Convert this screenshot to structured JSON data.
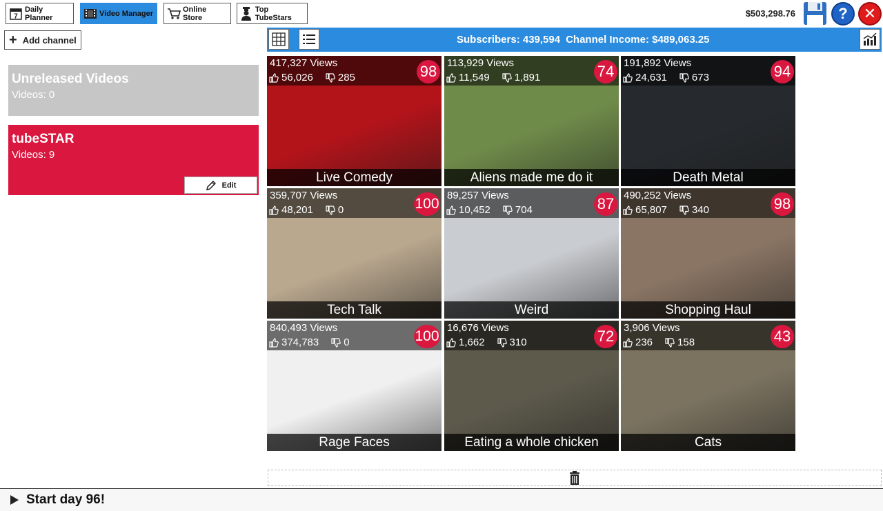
{
  "nav": {
    "daily_planner": "Daily Planner",
    "video_manager": "Video Manager",
    "online_store": "Online Store",
    "top_tubestars": "Top TubeStars",
    "calendar_day": "7"
  },
  "balance": "$503,298.76",
  "help_label": "?",
  "close_label": "✕",
  "sidebar": {
    "add_channel": "Add channel",
    "channels": [
      {
        "name": "Unreleased Videos",
        "videos": "Videos: 0"
      },
      {
        "name": "tubeSTAR",
        "videos": "Videos: 9",
        "edit_label": "Edit"
      }
    ]
  },
  "header": {
    "subscribers": "Subscribers: 439,594",
    "income": "Channel Income: $489,063.25"
  },
  "videos": [
    {
      "title": "Live Comedy",
      "views": "417,327 Views",
      "likes": "56,026",
      "dislikes": "285",
      "score": "98",
      "color": "#b2141a"
    },
    {
      "title": "Aliens made me do it",
      "views": "113,929 Views",
      "likes": "11,549",
      "dislikes": "1,891",
      "score": "74",
      "color": "#6f8b4a"
    },
    {
      "title": "Death Metal",
      "views": "191,892 Views",
      "likes": "24,631",
      "dislikes": "673",
      "score": "94",
      "color": "#262a2e"
    },
    {
      "title": "Tech Talk",
      "views": "359,707 Views",
      "likes": "48,201",
      "dislikes": "0",
      "score": "100",
      "color": "#b9a78e"
    },
    {
      "title": "Weird",
      "views": "89,257 Views",
      "likes": "10,452",
      "dislikes": "704",
      "score": "87",
      "color": "#c9ccd0"
    },
    {
      "title": "Shopping Haul",
      "views": "490,252 Views",
      "likes": "65,807",
      "dislikes": "340",
      "score": "98",
      "color": "#8a7564"
    },
    {
      "title": "Rage Faces",
      "views": "840,493 Views",
      "likes": "374,783",
      "dislikes": "0",
      "score": "100",
      "color": "#f0f0f0"
    },
    {
      "title": "Eating a whole chicken",
      "views": "16,676 Views",
      "likes": "1,662",
      "dislikes": "310",
      "score": "72",
      "color": "#5d5a4c"
    },
    {
      "title": "Cats",
      "views": "3,906 Views",
      "likes": "236",
      "dislikes": "158",
      "score": "43",
      "color": "#7b7360"
    }
  ],
  "footer": {
    "start_day": "Start day 96!"
  }
}
